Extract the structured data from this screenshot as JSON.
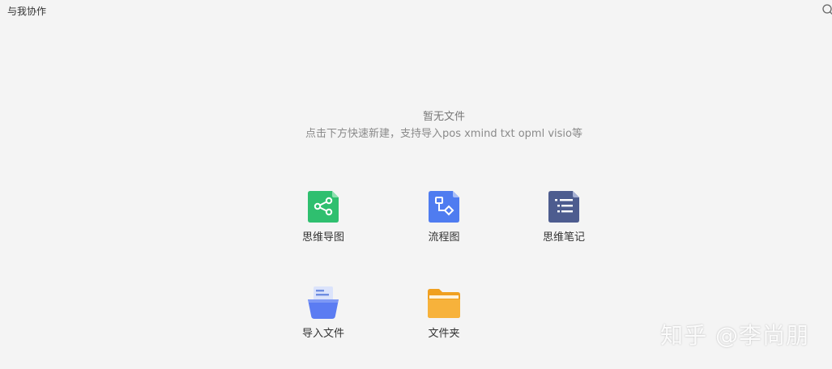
{
  "header": {
    "title": "与我协作",
    "search_icon": "search-icon"
  },
  "empty_state": {
    "title": "暂无文件",
    "hint": "点击下方快速新建，支持导入pos xmind txt opml visio等"
  },
  "actions": [
    {
      "label": "思维导图",
      "icon": "mindmap-icon",
      "color": "#2fbf6f"
    },
    {
      "label": "流程图",
      "icon": "flowchart-icon",
      "color": "#4f7cf0"
    },
    {
      "label": "思维笔记",
      "icon": "notes-icon",
      "color": "#4d5c8f"
    },
    {
      "label": "导入文件",
      "icon": "import-file-icon",
      "color": "#5b7cf2"
    },
    {
      "label": "文件夹",
      "icon": "folder-icon",
      "color": "#f5a623"
    }
  ],
  "watermark": "知乎 @李尚朋"
}
